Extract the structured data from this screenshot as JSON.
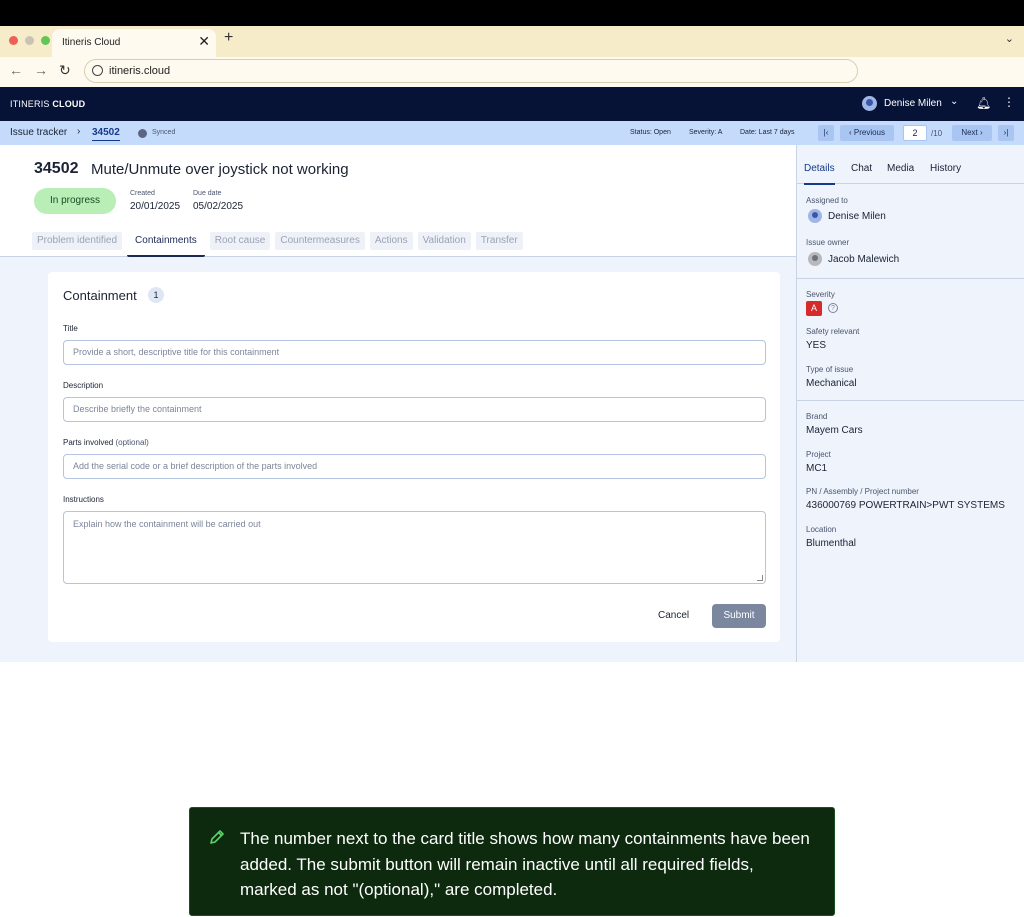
{
  "browser": {
    "tab_title": "Itineris Cloud",
    "tab_close": "✕",
    "new_tab": "+",
    "url": "itineris.cloud",
    "dot_colors": [
      "#ed5f57",
      "#f5bf4f",
      "#62c554"
    ]
  },
  "app": {
    "brand_light": "ITINERIS",
    "brand_bold": "CLOUD",
    "user_name": "Denise Milen"
  },
  "breadcrumb": {
    "root": "Issue tracker",
    "separator": "›",
    "current": "34502",
    "sync_status": "Synced"
  },
  "filters": {
    "status": "Status: Open",
    "severity": "Severity: A",
    "date": "Date: Last 7 days"
  },
  "pager": {
    "first": "|‹",
    "previous": "‹ Previous",
    "current": "2",
    "total": "/10",
    "next": "Next ›",
    "last": "›|"
  },
  "issue": {
    "id": "34502",
    "title": "Mute/Unmute over joystick not working",
    "status": "In progress",
    "created_label": "Created",
    "created": "20/01/2025",
    "due_label": "Due date",
    "due": "05/02/2025",
    "stages": [
      {
        "label": "Problem identified",
        "active": false
      },
      {
        "label": "Containments",
        "active": true
      },
      {
        "label": "Root cause",
        "active": false
      },
      {
        "label": "Countermeasures",
        "active": false
      },
      {
        "label": "Actions",
        "active": false
      },
      {
        "label": "Validation",
        "active": false
      },
      {
        "label": "Transfer",
        "active": false
      }
    ]
  },
  "form": {
    "title": "Containment",
    "count": "1",
    "fields": {
      "title_label": "Title",
      "title_placeholder": "Provide a short, descriptive title for this containment",
      "description_label": "Description",
      "description_placeholder": "Describe briefly the containment",
      "parts_label": "Parts involved",
      "parts_optional": "(optional)",
      "parts_placeholder": "Add the serial code or a brief description of the parts involved",
      "instructions_label": "Instructions",
      "instructions_placeholder": "Explain how the containment will be carried out"
    },
    "cancel": "Cancel",
    "submit": "Submit"
  },
  "side_panel": {
    "tabs": [
      "Details",
      "Chat",
      "Media",
      "History"
    ],
    "assigned_label": "Assigned to",
    "assigned": "Denise Milen",
    "owner_label": "Issue owner",
    "owner": "Jacob Malewich",
    "severity_label": "Severity",
    "severity": "A",
    "safety_label": "Safety relevant",
    "safety": "YES",
    "type_label": "Type of issue",
    "type": "Mechanical",
    "brand_label": "Brand",
    "brand": "Mayem Cars",
    "project_label": "Project",
    "project": "MC1",
    "pn_label": "PN / Assembly / Project number",
    "pn": "436000769 POWERTRAIN>PWT SYSTEMS",
    "location_label": "Location",
    "location": "Blumenthal"
  },
  "tip": {
    "text": "The number next to the card title shows how many containments have been added. The submit button will remain inactive until all required fields, marked as not \"(optional),\" are completed."
  }
}
